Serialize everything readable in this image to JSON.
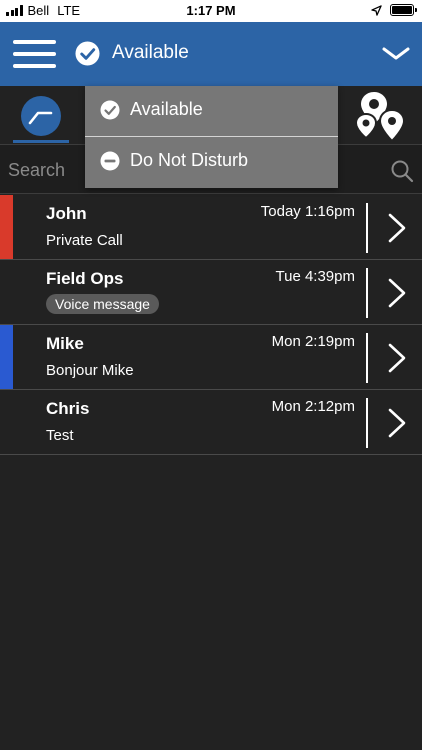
{
  "status_bar": {
    "carrier": "Bell",
    "network": "LTE",
    "time": "1:17 PM"
  },
  "header": {
    "status_label": "Available",
    "menu_icon": "hamburger-icon",
    "status_icon": "check-circle-icon",
    "dropdown_icon": "chevron-down-icon"
  },
  "search": {
    "placeholder": "Search",
    "value": ""
  },
  "status_menu": {
    "items": [
      {
        "label": "Available",
        "icon": "check-circle-icon"
      },
      {
        "label": "Do Not Disturb",
        "icon": "minus-circle-icon"
      }
    ]
  },
  "conversations": [
    {
      "name": "John",
      "time": "Today 1:16pm",
      "preview": "Private Call",
      "stripe_color": "#d93a2b"
    },
    {
      "name": "Field Ops",
      "time": "Tue 4:39pm",
      "badge": "Voice message",
      "stripe_color": ""
    },
    {
      "name": "Mike",
      "time": "Mon 2:19pm",
      "preview": "Bonjour Mike",
      "stripe_color": "#2a5ad1"
    },
    {
      "name": "Chris",
      "time": "Mon 2:12pm",
      "preview": "Test",
      "stripe_color": ""
    }
  ],
  "colors": {
    "brand_blue": "#2c64a6",
    "background": "#222222",
    "menu_gray": "#777777"
  }
}
